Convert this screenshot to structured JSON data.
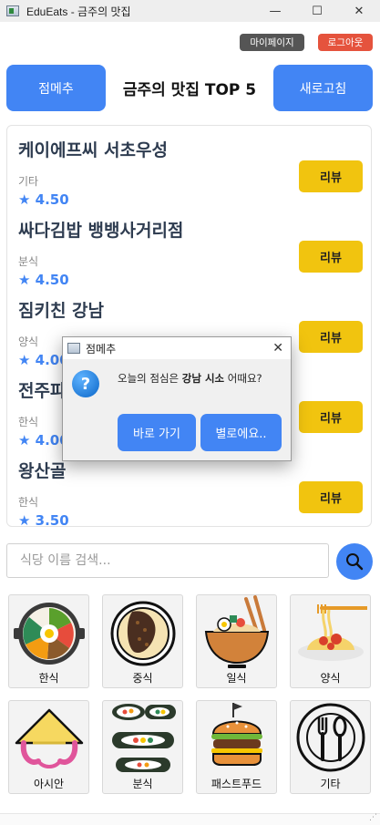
{
  "window": {
    "title": "EduEats - 금주의 맛집",
    "minimize": "—",
    "maximize": "☐",
    "close": "✕"
  },
  "header": {
    "mypage_label": "마이페이지",
    "logout_label": "로그아웃",
    "left_button": "점메추",
    "title": "금주의 맛집 TOP 5",
    "refresh_button": "새로고침"
  },
  "restaurants": [
    {
      "name": "케이에프씨 서초우성",
      "category": "기타",
      "rating": "★ 4.50",
      "review_label": "리뷰"
    },
    {
      "name": "싸다김밥 뱅뱅사거리점",
      "category": "분식",
      "rating": "★ 4.50",
      "review_label": "리뷰"
    },
    {
      "name": "짐키친 강남",
      "category": "양식",
      "rating": "★ 4.00",
      "review_label": "리뷰"
    },
    {
      "name": "전주파",
      "category": "한식",
      "rating": "★ 4.00",
      "review_label": "리뷰"
    },
    {
      "name": "왕산골",
      "category": "한식",
      "rating": "★ 3.50",
      "review_label": "리뷰"
    }
  ],
  "search": {
    "placeholder": "식당 이름 검색...",
    "icon": "search-icon"
  },
  "categories": [
    {
      "label": "한식",
      "icon": "bibimbap-icon"
    },
    {
      "label": "중식",
      "icon": "chinese-dish-icon"
    },
    {
      "label": "일식",
      "icon": "ramen-icon"
    },
    {
      "label": "양식",
      "icon": "pasta-icon"
    },
    {
      "label": "아시안",
      "icon": "conical-hat-icon"
    },
    {
      "label": "분식",
      "icon": "gimbap-icon"
    },
    {
      "label": "패스트푸드",
      "icon": "burger-icon"
    },
    {
      "label": "기타",
      "icon": "utensils-icon"
    }
  ],
  "dialog": {
    "title": "점메추",
    "close": "✕",
    "icon": "question-icon",
    "icon_glyph": "?",
    "message_prefix": "오늘의 점심은 ",
    "message_highlight": "강남 시소",
    "message_suffix": " 어때요?",
    "confirm_label": "바로 가기",
    "cancel_label": "별로에요.."
  },
  "colors": {
    "primary": "#4285f4",
    "review": "#f1c40f",
    "logout": "#e5533d",
    "mypage": "#555555"
  }
}
